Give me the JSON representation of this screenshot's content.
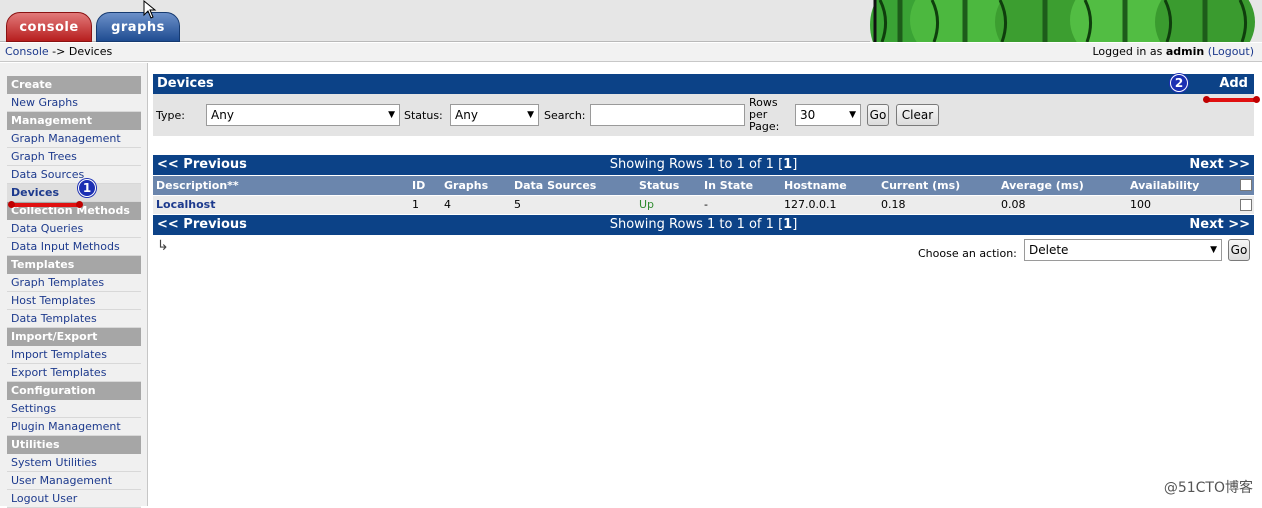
{
  "header": {
    "tabs": [
      {
        "label": "console"
      },
      {
        "label": "graphs"
      }
    ]
  },
  "breadcrumb": {
    "console": "Console",
    "separator": "->",
    "current": "Devices",
    "logged_prefix": "Logged in as",
    "user": "admin",
    "logout": "(Logout)"
  },
  "sidebar": {
    "sections": [
      {
        "title": "Create",
        "items": [
          "New Graphs"
        ]
      },
      {
        "title": "Management",
        "items": [
          "Graph Management",
          "Graph Trees",
          "Data Sources",
          "Devices"
        ]
      },
      {
        "title": "Collection Methods",
        "items": [
          "Data Queries",
          "Data Input Methods"
        ]
      },
      {
        "title": "Templates",
        "items": [
          "Graph Templates",
          "Host Templates",
          "Data Templates"
        ]
      },
      {
        "title": "Import/Export",
        "items": [
          "Import Templates",
          "Export Templates"
        ]
      },
      {
        "title": "Configuration",
        "items": [
          "Settings",
          "Plugin Management"
        ]
      },
      {
        "title": "Utilities",
        "items": [
          "System Utilities",
          "User Management",
          "Logout User"
        ]
      }
    ],
    "active_item": "Devices"
  },
  "devices_panel": {
    "title": "Devices",
    "add_label": "Add"
  },
  "filter": {
    "type_label": "Type:",
    "type_value": "Any",
    "status_label": "Status:",
    "status_value": "Any",
    "search_label": "Search:",
    "search_value": "",
    "rows_label_1": "Rows",
    "rows_label_2": "per",
    "rows_label_3": "Page:",
    "rows_value": "30",
    "go_label": "Go",
    "clear_label": "Clear"
  },
  "pager": {
    "prev": "<< Previous",
    "showing_prefix": "Showing Rows 1 to 1 of 1",
    "page_bracket_open": "[",
    "page": "1",
    "page_bracket_close": "]",
    "next": "Next >>"
  },
  "table": {
    "columns": [
      "Description**",
      "ID",
      "Graphs",
      "Data Sources",
      "Status",
      "In State",
      "Hostname",
      "Current (ms)",
      "Average (ms)",
      "Availability"
    ],
    "rows": [
      {
        "description": "Localhost",
        "id": "1",
        "graphs": "4",
        "data_sources": "5",
        "status": "Up",
        "in_state": "-",
        "hostname": "127.0.0.1",
        "current": "0.18",
        "average": "0.08",
        "availability": "100"
      }
    ]
  },
  "actions": {
    "label": "Choose an action:",
    "selected": "Delete",
    "go_label": "Go",
    "corner_arrow": "↳"
  },
  "annotations": {
    "badge_1": "1",
    "badge_2": "2"
  },
  "watermark": "@51CTO博客",
  "colors": {
    "bar_blue": "#0c4287",
    "header_blue": "#6b86ad",
    "status_up": "#2e8b2e",
    "badge_blue": "#1c2fb3",
    "annotation_red": "#e01010"
  }
}
